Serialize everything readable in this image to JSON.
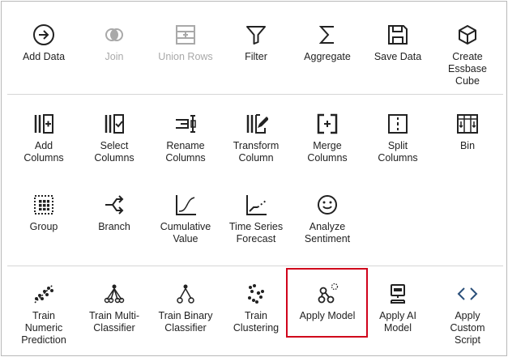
{
  "highlight_color": "#d0021b",
  "rows": {
    "data": [
      {
        "id": "add-data",
        "label": "Add Data",
        "icon": "arrow-right-circle-icon",
        "disabled": false
      },
      {
        "id": "join",
        "label": "Join",
        "icon": "join-icon",
        "disabled": true
      },
      {
        "id": "union-rows",
        "label": "Union Rows",
        "icon": "union-rows-icon",
        "disabled": true
      },
      {
        "id": "filter",
        "label": "Filter",
        "icon": "filter-icon",
        "disabled": false
      },
      {
        "id": "aggregate",
        "label": "Aggregate",
        "icon": "sigma-icon",
        "disabled": false
      },
      {
        "id": "save-data",
        "label": "Save Data",
        "icon": "save-icon",
        "disabled": false
      },
      {
        "id": "create-essbase-cube",
        "label": "Create\nEssbase\nCube",
        "icon": "cube-icon",
        "disabled": false
      }
    ],
    "transform1": [
      {
        "id": "add-columns",
        "label": "Add\nColumns",
        "icon": "add-columns-icon"
      },
      {
        "id": "select-columns",
        "label": "Select\nColumns",
        "icon": "select-columns-icon"
      },
      {
        "id": "rename-columns",
        "label": "Rename\nColumns",
        "icon": "rename-columns-icon"
      },
      {
        "id": "transform-column",
        "label": "Transform\nColumn",
        "icon": "transform-column-icon"
      },
      {
        "id": "merge-columns",
        "label": "Merge\nColumns",
        "icon": "merge-columns-icon"
      },
      {
        "id": "split-columns",
        "label": "Split\nColumns",
        "icon": "split-columns-icon"
      },
      {
        "id": "bin",
        "label": "Bin",
        "icon": "bin-icon"
      }
    ],
    "transform2": [
      {
        "id": "group",
        "label": "Group",
        "icon": "group-icon"
      },
      {
        "id": "branch",
        "label": "Branch",
        "icon": "branch-icon"
      },
      {
        "id": "cumulative-value",
        "label": "Cumulative\nValue",
        "icon": "cumulative-value-icon"
      },
      {
        "id": "time-series-forecast",
        "label": "Time Series\nForecast",
        "icon": "time-series-forecast-icon"
      },
      {
        "id": "analyze-sentiment",
        "label": "Analyze\nSentiment",
        "icon": "smiley-icon"
      }
    ],
    "ml": [
      {
        "id": "train-numeric-prediction",
        "label": "Train\nNumeric\nPrediction",
        "icon": "numeric-prediction-icon"
      },
      {
        "id": "train-multi-classifier",
        "label": "Train Multi-\nClassifier",
        "icon": "multi-classifier-icon"
      },
      {
        "id": "train-binary-classifier",
        "label": "Train Binary\nClassifier",
        "icon": "binary-classifier-icon"
      },
      {
        "id": "train-clustering",
        "label": "Train\nClustering",
        "icon": "clustering-icon"
      },
      {
        "id": "apply-model",
        "label": "Apply Model",
        "icon": "apply-model-icon"
      },
      {
        "id": "apply-ai-model",
        "label": "Apply AI\nModel",
        "icon": "robot-icon"
      },
      {
        "id": "apply-custom-script",
        "label": "Apply\nCustom\nScript",
        "icon": "code-brackets-icon"
      }
    ]
  }
}
